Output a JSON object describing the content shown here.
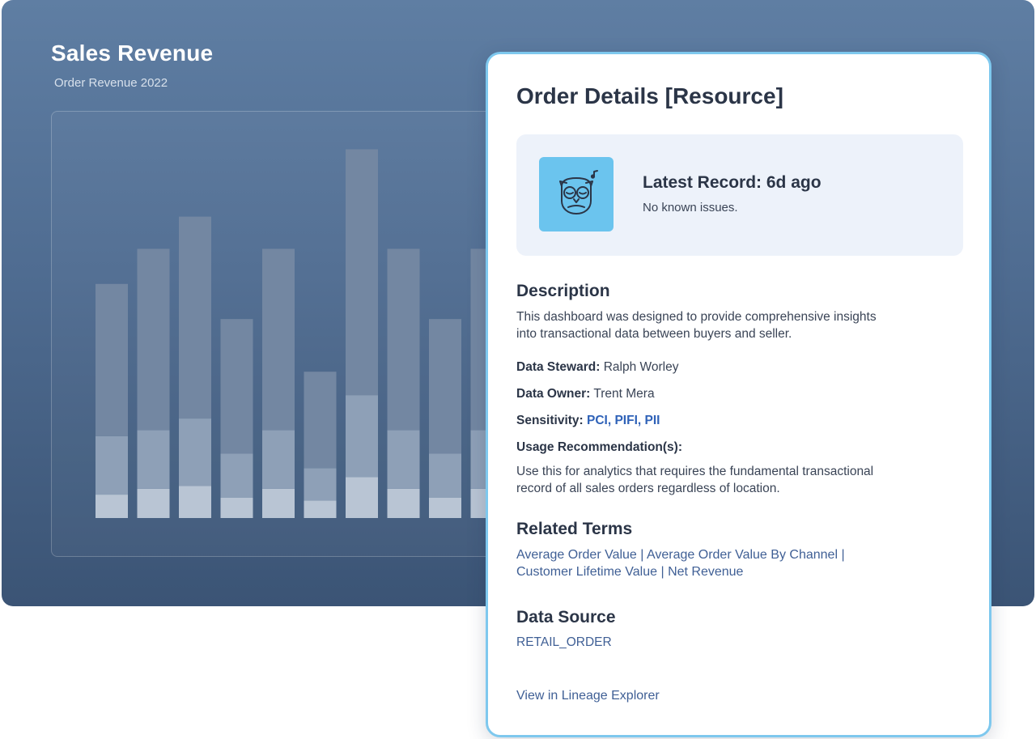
{
  "dashboard": {
    "title": "Sales Revenue",
    "subtitle": "Order Revenue 2022"
  },
  "chart_data": {
    "type": "bar",
    "stacked": true,
    "categories": [
      "",
      "",
      "",
      "",
      "",
      "",
      "",
      "",
      "",
      ""
    ],
    "series": [
      {
        "values": [
          8,
          10,
          11,
          7,
          10,
          6,
          14,
          10,
          7,
          10
        ]
      },
      {
        "values": [
          20,
          20,
          23,
          15,
          20,
          11,
          28,
          20,
          15,
          20
        ]
      },
      {
        "values": [
          52,
          62,
          69,
          46,
          62,
          33,
          84,
          62,
          46,
          62
        ]
      }
    ],
    "ylim": [
      0,
      130
    ],
    "grid": false,
    "colors": [
      "#b9c5d4",
      "#8ea0b7",
      "#7387a2"
    ]
  },
  "card": {
    "title": "Order Details [Resource]",
    "record": {
      "icon": "owl-icon",
      "title": "Latest Record: 6d ago",
      "status": "No known issues."
    },
    "description": {
      "heading": "Description",
      "text_line1": "This dashboard was designed to provide comprehensive insights",
      "text_line2": "into transactional data between buyers and seller."
    },
    "fields": {
      "steward_label": "Data Steward:",
      "steward_value": "Ralph Worley",
      "owner_label": "Data Owner:",
      "owner_value": "Trent Mera",
      "sensitivity_label": "Sensitivity:",
      "sensitivity_value": "PCI, PIFI, PII",
      "usage_label": "Usage Recommendation(s):",
      "usage_line1": "Use this for analytics that requires the fundamental transactional",
      "usage_line2": "record of all sales orders regardless of location."
    },
    "related": {
      "heading": "Related Terms",
      "terms": [
        "Average Order Value",
        "Average Order Value By Channel",
        "Customer Lifetime Value",
        "Net Revenue"
      ],
      "separator": "|"
    },
    "source": {
      "heading": "Data Source",
      "value": "RETAIL_ORDER"
    },
    "lineage_link": "View in Lineage Explorer"
  },
  "colors": {
    "card_border": "#7ec8ee",
    "owl_tile": "#6bc4ee",
    "link": "#3f5f95",
    "sensitivity": "#2f62b8"
  }
}
